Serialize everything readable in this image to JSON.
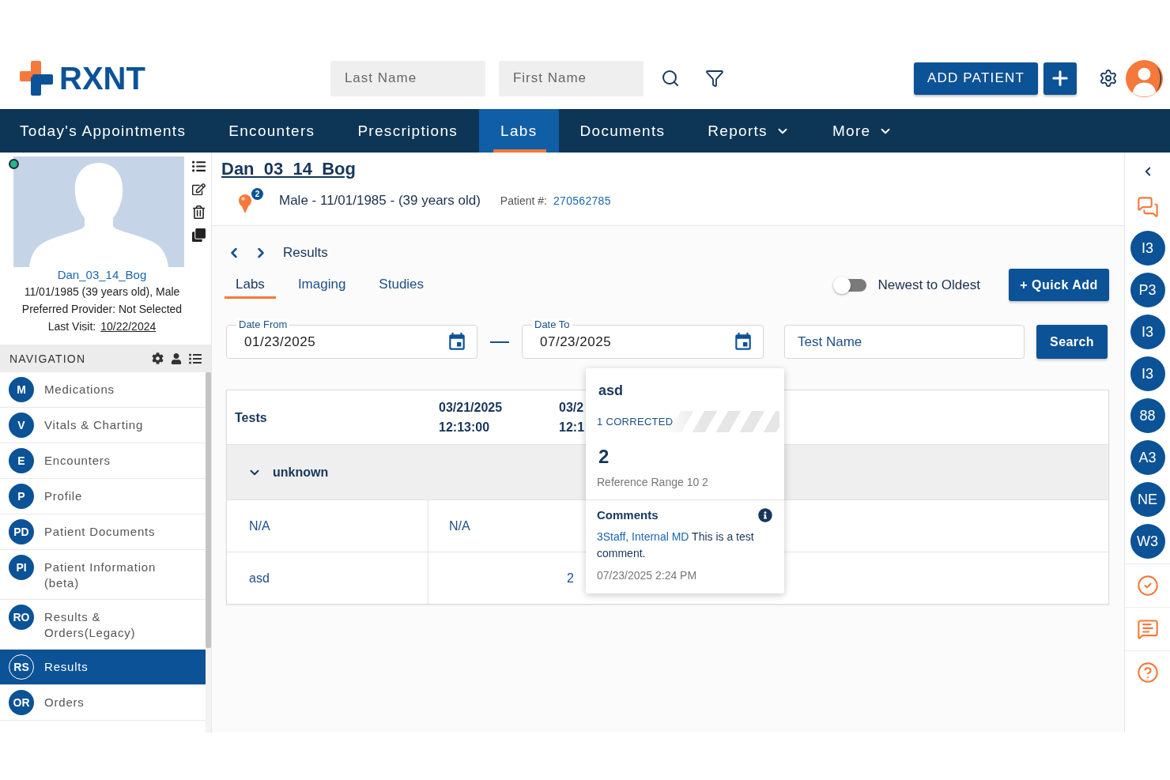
{
  "header": {
    "logo_text": "RXNT",
    "last_name": {
      "placeholder": "Last Name"
    },
    "first_name": {
      "placeholder": "First Name"
    },
    "add_patient_button": "ADD PATIENT"
  },
  "main_nav": [
    {
      "label": "Today's Appointments",
      "selected": false,
      "dropdown": false
    },
    {
      "label": "Encounters",
      "selected": false,
      "dropdown": false
    },
    {
      "label": "Prescriptions",
      "selected": false,
      "dropdown": false
    },
    {
      "label": "Labs",
      "selected": true,
      "dropdown": false
    },
    {
      "label": "Documents",
      "selected": false,
      "dropdown": false
    },
    {
      "label": "Reports",
      "selected": false,
      "dropdown": true
    },
    {
      "label": "More",
      "selected": false,
      "dropdown": true
    }
  ],
  "patient_card": {
    "name": "Dan_03_14_Bog",
    "birth_info": "11/01/1985 (39 years old), Male",
    "preferred_provider": "Preferred Provider: Not Selected",
    "last_visit_label": "Last Visit:",
    "last_visit_date": "10/22/2024"
  },
  "navigation": {
    "title": "NAVIGATION",
    "items": [
      {
        "initials": "M",
        "label": "Medications",
        "selected": false
      },
      {
        "initials": "V",
        "label": "Vitals & Charting",
        "selected": false
      },
      {
        "initials": "E",
        "label": "Encounters",
        "selected": false
      },
      {
        "initials": "P",
        "label": "Profile",
        "selected": false
      },
      {
        "initials": "PD",
        "label": "Patient Documents",
        "selected": false
      },
      {
        "initials": "PI",
        "label": "Patient Information (beta)",
        "selected": false
      },
      {
        "initials": "RO",
        "label": "Results & Orders(Legacy)",
        "selected": false
      },
      {
        "initials": "RS",
        "label": "Results",
        "selected": true
      },
      {
        "initials": "OR",
        "label": "Orders",
        "selected": false
      }
    ]
  },
  "patient_header": {
    "name": "Dan_03_14_Bog",
    "alert_count": "2",
    "summary": "Male - 11/01/1985 - (39 years old)",
    "patient_number_label": "Patient #:",
    "patient_number": "270562785"
  },
  "breadcrumb": {
    "title": "Results"
  },
  "result_tabs": [
    {
      "label": "Labs",
      "selected": true
    },
    {
      "label": "Imaging",
      "selected": false
    },
    {
      "label": "Studies",
      "selected": false
    }
  ],
  "sort_toggle": {
    "label": "Newest to Oldest",
    "on": false
  },
  "quick_add_button": "+ Quick Add",
  "filters": {
    "date_from": {
      "label": "Date From",
      "value": "01/23/2025"
    },
    "date_to": {
      "label": "Date To",
      "value": "07/23/2025"
    },
    "test_name": {
      "placeholder": "Test Name"
    },
    "search_button": "Search"
  },
  "table": {
    "columns": [
      {
        "label": "Tests"
      },
      {
        "label": "03/21/2025 12:13:00"
      },
      {
        "label": "03/2 12:1"
      }
    ],
    "groups": [
      {
        "name": "unknown",
        "expanded": true,
        "rows": [
          {
            "test": "N/A",
            "value": "N/A",
            "kind": "not-available"
          },
          {
            "test": "asd",
            "value": "2",
            "kind": "result"
          }
        ]
      }
    ]
  },
  "result_popup": {
    "title": "asd",
    "status": "1 CORRECTED",
    "value": "2",
    "reference_range": "Reference Range 10 2",
    "comments_label": "Comments",
    "comment_author": "3Staff, Internal MD",
    "comment_text": "This is a test comment.",
    "timestamp": "07/23/2025 2:24 PM"
  },
  "right_rail": {
    "initials": [
      "I3",
      "P3",
      "I3",
      "I3",
      "88",
      "A3",
      "NE",
      "W3"
    ]
  }
}
